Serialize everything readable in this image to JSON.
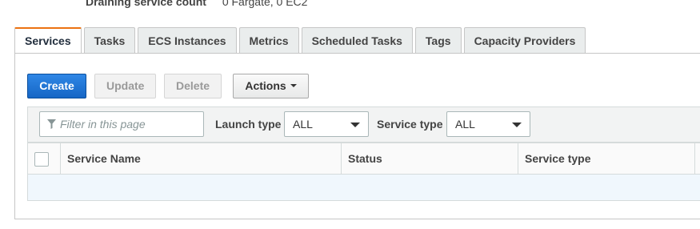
{
  "summary": {
    "label": "Draining service count",
    "value": "0 Fargate, 0 EC2"
  },
  "tabs": [
    {
      "label": "Services",
      "active": true
    },
    {
      "label": "Tasks"
    },
    {
      "label": "ECS Instances"
    },
    {
      "label": "Metrics"
    },
    {
      "label": "Scheduled Tasks"
    },
    {
      "label": "Tags"
    },
    {
      "label": "Capacity Providers"
    }
  ],
  "toolbar": {
    "create_label": "Create",
    "update_label": "Update",
    "delete_label": "Delete",
    "actions_label": "Actions"
  },
  "filters": {
    "search_placeholder": "Filter in this page",
    "launch_type_label": "Launch type",
    "launch_type_value": "ALL",
    "service_type_label": "Service type",
    "service_type_value": "ALL"
  },
  "table": {
    "columns": [
      "Service Name",
      "Status",
      "Service type"
    ],
    "rows": []
  },
  "colors": {
    "primary": "#1a6fd4",
    "tab_accent": "#ec7211",
    "row_highlight": "#f0f7fd"
  },
  "icons": {
    "filter": "funnel-icon",
    "dropdown": "caret-down-icon"
  }
}
